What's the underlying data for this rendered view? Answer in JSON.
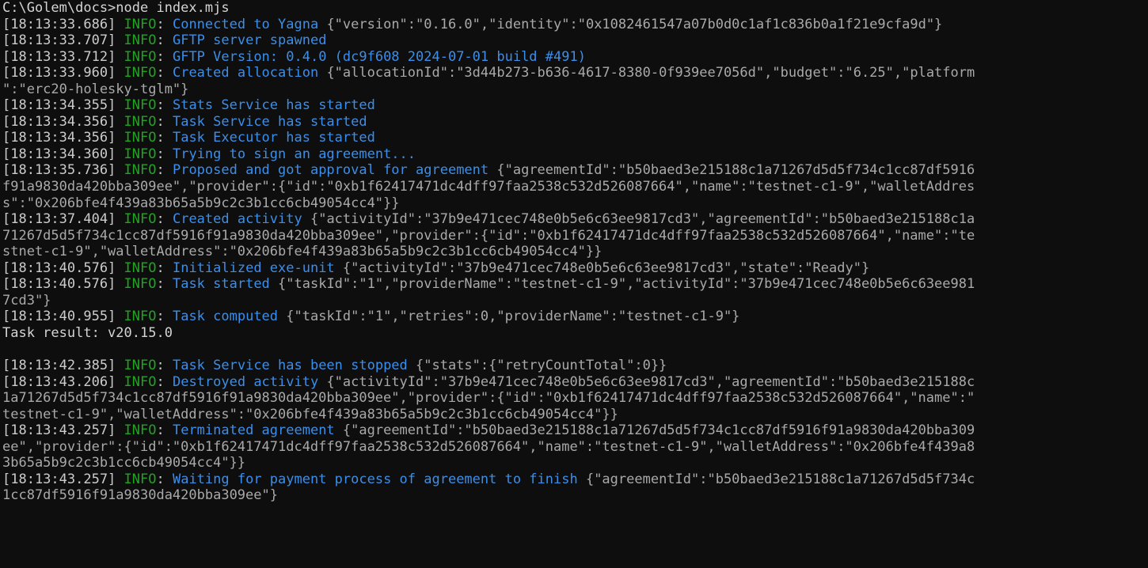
{
  "window": {
    "title": "Command Prompt - node index.mjs",
    "background_color": "#0e0e0e",
    "font_size_px": 17,
    "columns": 143
  },
  "colors": {
    "default": "#cccccc",
    "timestamp": "#cccccc",
    "info_level": "#22a322",
    "message": "#3b8eea",
    "json_payload": "#a9a9a9",
    "result_text": "#d4d4d4"
  },
  "prompt": {
    "path": "C:\\Golem\\docs",
    "symbol": ">",
    "command": "node index.mjs"
  },
  "shared_values": {
    "agreement_id": "b50baed3e215188c1a71267d5d5f734c1cc87df5916f91a9830da420bba309ee",
    "activity_id": "37b9e471cec748e0b5e6c63ee9817cd3",
    "provider_id": "0xb1f62417471dc4dff97faa2538c532d526087664",
    "provider_name": "testnet-c1-9",
    "wallet_address": "0x206bfe4f439a83b65a5b9c2c3b1cc6cb49054cc4",
    "identity": "0x1082461547a07b0d0c1af1c836b0a1f21e9cfa9d",
    "allocation_id": "3d44b273-b636-4617-8380-0f939ee7056d",
    "yagna_version": "0.16.0",
    "gftp_version": "0.4.0",
    "gftp_build": "dc9f608 2024-07-01 build #491",
    "budget": "6.25",
    "platform": "erc20-holesky-tglm",
    "task_id": "1",
    "node_version": "v20.15.0",
    "exe_unit_state": "Ready",
    "retries": "0",
    "retry_count_total": "0"
  },
  "lines": [
    {
      "type": "prompt",
      "segments": [
        {
          "style": "prompt",
          "text": "C:\\Golem\\docs>node index.mjs"
        }
      ]
    },
    {
      "type": "log",
      "timestamp": "[18:13:33.686]",
      "level": "INFO",
      "message": "Connected to Yagna",
      "payload": "{\"version\":\"0.16.0\",\"identity\":\"0x1082461547a07b0d0c1af1c836b0a1f21e9cfa9d\"}",
      "segments": [
        {
          "style": "time",
          "text": "[18:13:33.686] "
        },
        {
          "style": "info",
          "text": "INFO"
        },
        {
          "style": "default",
          "text": ": "
        },
        {
          "style": "msg",
          "text": "Connected to Yagna"
        },
        {
          "style": "json",
          "text": " {\"version\":\"0.16.0\",\"identity\":\"0x1082461547a07b0d0c1af1c836b0a1f21e9cfa9d\"}"
        }
      ]
    },
    {
      "type": "log",
      "timestamp": "[18:13:33.707]",
      "level": "INFO",
      "message": "GFTP server spawned",
      "payload": "",
      "segments": [
        {
          "style": "time",
          "text": "[18:13:33.707] "
        },
        {
          "style": "info",
          "text": "INFO"
        },
        {
          "style": "default",
          "text": ": "
        },
        {
          "style": "msg",
          "text": "GFTP server spawned"
        }
      ]
    },
    {
      "type": "log",
      "timestamp": "[18:13:33.712]",
      "level": "INFO",
      "message": "GFTP Version: 0.4.0 (dc9f608 2024-07-01 build #491)",
      "payload": "",
      "segments": [
        {
          "style": "time",
          "text": "[18:13:33.712] "
        },
        {
          "style": "info",
          "text": "INFO"
        },
        {
          "style": "default",
          "text": ": "
        },
        {
          "style": "msg",
          "text": "GFTP Version: 0.4.0 (dc9f608 2024-07-01 build #491)"
        }
      ]
    },
    {
      "type": "log",
      "timestamp": "[18:13:33.960]",
      "level": "INFO",
      "message": "Created allocation",
      "payload": "{\"allocationId\":\"3d44b273-b636-4617-8380-0f939ee7056d\",\"budget\":\"6.25\",\"platform\":\"erc20-holesky-tglm\"}",
      "segments": [
        {
          "style": "time",
          "text": "[18:13:33.960] "
        },
        {
          "style": "info",
          "text": "INFO"
        },
        {
          "style": "default",
          "text": ": "
        },
        {
          "style": "msg",
          "text": "Created allocation"
        },
        {
          "style": "json",
          "text": " {\"allocationId\":\"3d44b273-b636-4617-8380-0f939ee7056d\",\"budget\":\"6.25\",\"platform"
        }
      ]
    },
    {
      "type": "wrap",
      "segments": [
        {
          "style": "json",
          "text": "\":\"erc20-holesky-tglm\"}"
        }
      ]
    },
    {
      "type": "log",
      "timestamp": "[18:13:34.355]",
      "level": "INFO",
      "message": "Stats Service has started",
      "payload": "",
      "segments": [
        {
          "style": "time",
          "text": "[18:13:34.355] "
        },
        {
          "style": "info",
          "text": "INFO"
        },
        {
          "style": "default",
          "text": ": "
        },
        {
          "style": "msg",
          "text": "Stats Service has started"
        }
      ]
    },
    {
      "type": "log",
      "timestamp": "[18:13:34.356]",
      "level": "INFO",
      "message": "Task Service has started",
      "payload": "",
      "segments": [
        {
          "style": "time",
          "text": "[18:13:34.356] "
        },
        {
          "style": "info",
          "text": "INFO"
        },
        {
          "style": "default",
          "text": ": "
        },
        {
          "style": "msg",
          "text": "Task Service has started"
        }
      ]
    },
    {
      "type": "log",
      "timestamp": "[18:13:34.356]",
      "level": "INFO",
      "message": "Task Executor has started",
      "payload": "",
      "segments": [
        {
          "style": "time",
          "text": "[18:13:34.356] "
        },
        {
          "style": "info",
          "text": "INFO"
        },
        {
          "style": "default",
          "text": ": "
        },
        {
          "style": "msg",
          "text": "Task Executor has started"
        }
      ]
    },
    {
      "type": "log",
      "timestamp": "[18:13:34.360]",
      "level": "INFO",
      "message": "Trying to sign an agreement...",
      "payload": "",
      "segments": [
        {
          "style": "time",
          "text": "[18:13:34.360] "
        },
        {
          "style": "info",
          "text": "INFO"
        },
        {
          "style": "default",
          "text": ": "
        },
        {
          "style": "msg",
          "text": "Trying to sign an agreement..."
        }
      ]
    },
    {
      "type": "log",
      "timestamp": "[18:13:35.736]",
      "level": "INFO",
      "message": "Proposed and got approval for agreement",
      "payload": "{\"agreementId\":\"b50baed3e215188c1a71267d5d5f734c1cc87df5916f91a9830da420bba309ee\",\"provider\":{\"id\":\"0xb1f62417471dc4dff97faa2538c532d526087664\",\"name\":\"testnet-c1-9\",\"walletAddress\":\"0x206bfe4f439a83b65a5b9c2c3b1cc6cb49054cc4\"}}",
      "segments": [
        {
          "style": "time",
          "text": "[18:13:35.736] "
        },
        {
          "style": "info",
          "text": "INFO"
        },
        {
          "style": "default",
          "text": ": "
        },
        {
          "style": "msg",
          "text": "Proposed and got approval for agreement"
        },
        {
          "style": "json",
          "text": " {\"agreementId\":\"b50baed3e215188c1a71267d5d5f734c1cc87df5916"
        }
      ]
    },
    {
      "type": "wrap",
      "segments": [
        {
          "style": "json",
          "text": "f91a9830da420bba309ee\",\"provider\":{\"id\":\"0xb1f62417471dc4dff97faa2538c532d526087664\",\"name\":\"testnet-c1-9\",\"walletAddres"
        }
      ]
    },
    {
      "type": "wrap",
      "segments": [
        {
          "style": "json",
          "text": "s\":\"0x206bfe4f439a83b65a5b9c2c3b1cc6cb49054cc4\"}}"
        }
      ]
    },
    {
      "type": "log",
      "timestamp": "[18:13:37.404]",
      "level": "INFO",
      "message": "Created activity",
      "payload": "{\"activityId\":\"37b9e471cec748e0b5e6c63ee9817cd3\",\"agreementId\":\"b50baed3e215188c1a71267d5d5f734c1cc87df5916f91a9830da420bba309ee\",\"provider\":{\"id\":\"0xb1f62417471dc4dff97faa2538c532d526087664\",\"name\":\"testnet-c1-9\",\"walletAddress\":\"0x206bfe4f439a83b65a5b9c2c3b1cc6cb49054cc4\"}}",
      "segments": [
        {
          "style": "time",
          "text": "[18:13:37.404] "
        },
        {
          "style": "info",
          "text": "INFO"
        },
        {
          "style": "default",
          "text": ": "
        },
        {
          "style": "msg",
          "text": "Created activity"
        },
        {
          "style": "json",
          "text": " {\"activityId\":\"37b9e471cec748e0b5e6c63ee9817cd3\",\"agreementId\":\"b50baed3e215188c1a"
        }
      ]
    },
    {
      "type": "wrap",
      "segments": [
        {
          "style": "json",
          "text": "71267d5d5f734c1cc87df5916f91a9830da420bba309ee\",\"provider\":{\"id\":\"0xb1f62417471dc4dff97faa2538c532d526087664\",\"name\":\"te"
        }
      ]
    },
    {
      "type": "wrap",
      "segments": [
        {
          "style": "json",
          "text": "stnet-c1-9\",\"walletAddress\":\"0x206bfe4f439a83b65a5b9c2c3b1cc6cb49054cc4\"}}"
        }
      ]
    },
    {
      "type": "log",
      "timestamp": "[18:13:40.576]",
      "level": "INFO",
      "message": "Initialized exe-unit",
      "payload": "{\"activityId\":\"37b9e471cec748e0b5e6c63ee9817cd3\",\"state\":\"Ready\"}",
      "segments": [
        {
          "style": "time",
          "text": "[18:13:40.576] "
        },
        {
          "style": "info",
          "text": "INFO"
        },
        {
          "style": "default",
          "text": ": "
        },
        {
          "style": "msg",
          "text": "Initialized exe-unit"
        },
        {
          "style": "json",
          "text": " {\"activityId\":\"37b9e471cec748e0b5e6c63ee9817cd3\",\"state\":\"Ready\"}"
        }
      ]
    },
    {
      "type": "log",
      "timestamp": "[18:13:40.576]",
      "level": "INFO",
      "message": "Task started",
      "payload": "{\"taskId\":\"1\",\"providerName\":\"testnet-c1-9\",\"activityId\":\"37b9e471cec748e0b5e6c63ee9817cd3\"}",
      "segments": [
        {
          "style": "time",
          "text": "[18:13:40.576] "
        },
        {
          "style": "info",
          "text": "INFO"
        },
        {
          "style": "default",
          "text": ": "
        },
        {
          "style": "msg",
          "text": "Task started"
        },
        {
          "style": "json",
          "text": " {\"taskId\":\"1\",\"providerName\":\"testnet-c1-9\",\"activityId\":\"37b9e471cec748e0b5e6c63ee981"
        }
      ]
    },
    {
      "type": "wrap",
      "segments": [
        {
          "style": "json",
          "text": "7cd3\"}"
        }
      ]
    },
    {
      "type": "log",
      "timestamp": "[18:13:40.955]",
      "level": "INFO",
      "message": "Task computed",
      "payload": "{\"taskId\":\"1\",\"retries\":0,\"providerName\":\"testnet-c1-9\"}",
      "segments": [
        {
          "style": "time",
          "text": "[18:13:40.955] "
        },
        {
          "style": "info",
          "text": "INFO"
        },
        {
          "style": "default",
          "text": ": "
        },
        {
          "style": "msg",
          "text": "Task computed"
        },
        {
          "style": "json",
          "text": " {\"taskId\":\"1\",\"retries\":0,\"providerName\":\"testnet-c1-9\"}"
        }
      ]
    },
    {
      "type": "result",
      "segments": [
        {
          "style": "result",
          "text": "Task result: v20.15.0"
        }
      ]
    },
    {
      "type": "blank",
      "segments": [
        {
          "style": "default",
          "text": ""
        }
      ]
    },
    {
      "type": "log",
      "timestamp": "[18:13:42.385]",
      "level": "INFO",
      "message": "Task Service has been stopped",
      "payload": "{\"stats\":{\"retryCountTotal\":0}}",
      "segments": [
        {
          "style": "time",
          "text": "[18:13:42.385] "
        },
        {
          "style": "info",
          "text": "INFO"
        },
        {
          "style": "default",
          "text": ": "
        },
        {
          "style": "msg",
          "text": "Task Service has been stopped"
        },
        {
          "style": "json",
          "text": " {\"stats\":{\"retryCountTotal\":0}}"
        }
      ]
    },
    {
      "type": "log",
      "timestamp": "[18:13:43.206]",
      "level": "INFO",
      "message": "Destroyed activity",
      "payload": "{\"activityId\":\"37b9e471cec748e0b5e6c63ee9817cd3\",\"agreementId\":\"b50baed3e215188c1a71267d5d5f734c1cc87df5916f91a9830da420bba309ee\",\"provider\":{\"id\":\"0xb1f62417471dc4dff97faa2538c532d526087664\",\"name\":\"testnet-c1-9\",\"walletAddress\":\"0x206bfe4f439a83b65a5b9c2c3b1cc6cb49054cc4\"}}",
      "segments": [
        {
          "style": "time",
          "text": "[18:13:43.206] "
        },
        {
          "style": "info",
          "text": "INFO"
        },
        {
          "style": "default",
          "text": ": "
        },
        {
          "style": "msg",
          "text": "Destroyed activity"
        },
        {
          "style": "json",
          "text": " {\"activityId\":\"37b9e471cec748e0b5e6c63ee9817cd3\",\"agreementId\":\"b50baed3e215188c"
        }
      ]
    },
    {
      "type": "wrap",
      "segments": [
        {
          "style": "json",
          "text": "1a71267d5d5f734c1cc87df5916f91a9830da420bba309ee\",\"provider\":{\"id\":\"0xb1f62417471dc4dff97faa2538c532d526087664\",\"name\":\""
        }
      ]
    },
    {
      "type": "wrap",
      "segments": [
        {
          "style": "json",
          "text": "testnet-c1-9\",\"walletAddress\":\"0x206bfe4f439a83b65a5b9c2c3b1cc6cb49054cc4\"}}"
        }
      ]
    },
    {
      "type": "log",
      "timestamp": "[18:13:43.257]",
      "level": "INFO",
      "message": "Terminated agreement",
      "payload": "{\"agreementId\":\"b50baed3e215188c1a71267d5d5f734c1cc87df5916f91a9830da420bba309ee\",\"provider\":{\"id\":\"0xb1f62417471dc4dff97faa2538c532d526087664\",\"name\":\"testnet-c1-9\",\"walletAddress\":\"0x206bfe4f439a83b65a5b9c2c3b1cc6cb49054cc4\"}}",
      "segments": [
        {
          "style": "time",
          "text": "[18:13:43.257] "
        },
        {
          "style": "info",
          "text": "INFO"
        },
        {
          "style": "default",
          "text": ": "
        },
        {
          "style": "msg",
          "text": "Terminated agreement"
        },
        {
          "style": "json",
          "text": " {\"agreementId\":\"b50baed3e215188c1a71267d5d5f734c1cc87df5916f91a9830da420bba309"
        }
      ]
    },
    {
      "type": "wrap",
      "segments": [
        {
          "style": "json",
          "text": "ee\",\"provider\":{\"id\":\"0xb1f62417471dc4dff97faa2538c532d526087664\",\"name\":\"testnet-c1-9\",\"walletAddress\":\"0x206bfe4f439a8"
        }
      ]
    },
    {
      "type": "wrap",
      "segments": [
        {
          "style": "json",
          "text": "3b65a5b9c2c3b1cc6cb49054cc4\"}}"
        }
      ]
    },
    {
      "type": "log",
      "timestamp": "[18:13:43.257]",
      "level": "INFO",
      "message": "Waiting for payment process of agreement to finish",
      "payload": "{\"agreementId\":\"b50baed3e215188c1a71267d5d5f734c1cc87df5916f91a9830da420bba309ee\"}",
      "segments": [
        {
          "style": "time",
          "text": "[18:13:43.257] "
        },
        {
          "style": "info",
          "text": "INFO"
        },
        {
          "style": "default",
          "text": ": "
        },
        {
          "style": "msg",
          "text": "Waiting for payment process of agreement to finish"
        },
        {
          "style": "json",
          "text": " {\"agreementId\":\"b50baed3e215188c1a71267d5d5f734c"
        }
      ]
    },
    {
      "type": "wrap",
      "segments": [
        {
          "style": "json",
          "text": "1cc87df5916f91a9830da420bba309ee\"}"
        }
      ]
    }
  ]
}
